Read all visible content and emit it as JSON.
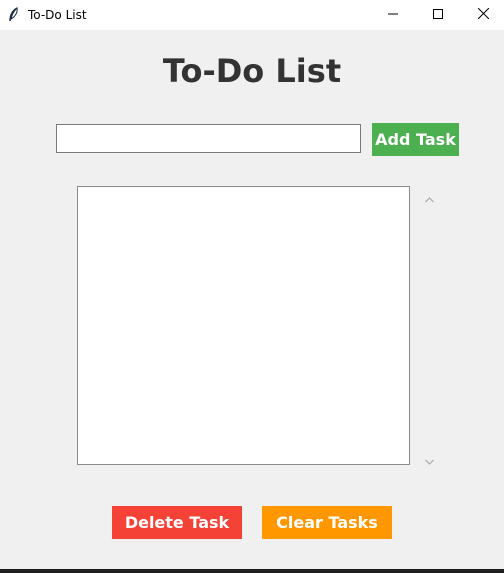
{
  "window": {
    "title": "To-Do List",
    "icon": "feather-icon",
    "controls": [
      "minimize-icon",
      "maximize-icon",
      "close-icon"
    ]
  },
  "header": {
    "title": "To-Do List"
  },
  "task_input": {
    "value": "",
    "placeholder": ""
  },
  "buttons": {
    "add": "Add Task",
    "delete": "Delete Task",
    "clear": "Clear Tasks"
  },
  "task_list": {
    "items": []
  },
  "colors": {
    "background": "#f0f0f0",
    "heading_text": "#333333",
    "add_button": "#4caf50",
    "delete_button": "#f44336",
    "clear_button": "#ff9800"
  }
}
